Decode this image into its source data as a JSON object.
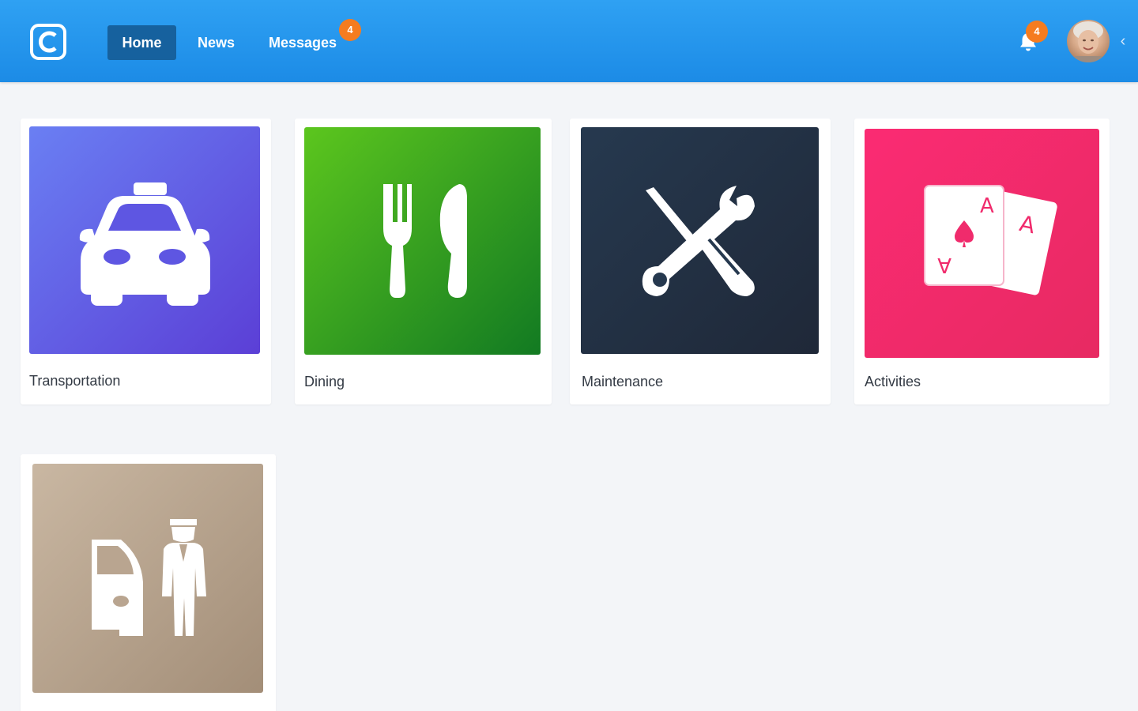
{
  "header": {
    "logo_icon": "app-logo-icon",
    "nav": [
      {
        "label": "Home",
        "active": true
      },
      {
        "label": "News",
        "active": false
      },
      {
        "label": "Messages",
        "active": false,
        "badge": "4"
      }
    ],
    "notifications": {
      "icon": "bell-icon",
      "badge": "4"
    },
    "avatar_icon": "user-avatar",
    "chevron_icon": "chevron-left-icon"
  },
  "cards": [
    {
      "label": "Transportation",
      "icon": "taxi-icon",
      "color_from": "#6a7ff3",
      "color_to": "#5b3fd6"
    },
    {
      "label": "Dining",
      "icon": "fork-knife-icon",
      "color_from": "#5cc61e",
      "color_to": "#127a22"
    },
    {
      "label": "Maintenance",
      "icon": "tools-icon",
      "color_from": "#26394f",
      "color_to": "#1f2838"
    },
    {
      "label": "Activities",
      "icon": "playing-cards-icon",
      "color_from": "#fb2b73",
      "color_to": "#e72a62"
    },
    {
      "label": "",
      "icon": "valet-icon",
      "color_from": "#c9b7a2",
      "color_to": "#a38e78"
    }
  ],
  "colors": {
    "header": "#2196f3",
    "active_nav": "#16619e",
    "badge": "#f57c1f",
    "background": "#f3f5f8"
  }
}
